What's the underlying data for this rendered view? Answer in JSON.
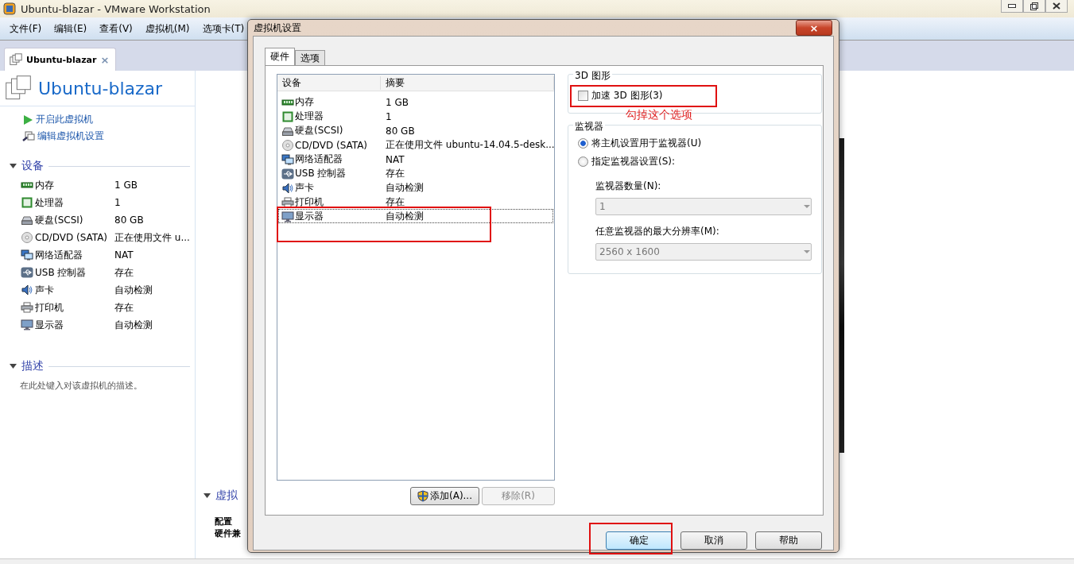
{
  "window": {
    "title": "Ubuntu-blazar - VMware Workstation"
  },
  "menu": [
    "文件(F)",
    "编辑(E)",
    "查看(V)",
    "虚拟机(M)",
    "选项卡(T)"
  ],
  "tabs": [
    {
      "label": "Ubuntu-blazar",
      "selected": true,
      "close": "×"
    }
  ],
  "vm": {
    "name": "Ubuntu-blazar",
    "actions": [
      {
        "kind": "play",
        "label": "开启此虚拟机"
      },
      {
        "kind": "edit",
        "label": "编辑虚拟机设置"
      }
    ],
    "devices_section": {
      "title": "设备",
      "expanded": true,
      "items": [
        {
          "kind": "memory",
          "name": "内存",
          "summary": "1 GB"
        },
        {
          "kind": "cpu",
          "name": "处理器",
          "summary": "1"
        },
        {
          "kind": "disk",
          "name": "硬盘(SCSI)",
          "summary": "80 GB"
        },
        {
          "kind": "cdrom",
          "name": "CD/DVD (SATA)",
          "summary": "正在使用文件 u..."
        },
        {
          "kind": "network",
          "name": "网络适配器",
          "summary": "NAT"
        },
        {
          "kind": "usb",
          "name": "USB 控制器",
          "summary": "存在"
        },
        {
          "kind": "sound",
          "name": "声卡",
          "summary": "自动检测"
        },
        {
          "kind": "printer",
          "name": "打印机",
          "summary": "存在"
        },
        {
          "kind": "display",
          "name": "显示器",
          "summary": "自动检测"
        }
      ]
    },
    "description_section": {
      "title": "描述",
      "expanded": true,
      "placeholder": "在此处键入对该虚拟机的描述。"
    },
    "details_section": {
      "title": "虚拟",
      "expanded": true,
      "labels": [
        "配置",
        "硬件兼"
      ]
    }
  },
  "dialog": {
    "title": "虚拟机设置",
    "close": "×",
    "tabs": [
      {
        "label": "硬件",
        "selected": true
      },
      {
        "label": "选项",
        "selected": false
      }
    ],
    "device_table": {
      "columns": [
        "设备",
        "摘要"
      ],
      "rows": [
        {
          "kind": "memory",
          "name": "内存",
          "summary": "1 GB",
          "selected": false,
          "highlighted": false
        },
        {
          "kind": "cpu",
          "name": "处理器",
          "summary": "1",
          "selected": false,
          "highlighted": false
        },
        {
          "kind": "disk",
          "name": "硬盘(SCSI)",
          "summary": "80 GB",
          "selected": false,
          "highlighted": false
        },
        {
          "kind": "cdrom",
          "name": "CD/DVD (SATA)",
          "summary": "正在使用文件 ubuntu-14.04.5-desk...",
          "selected": false,
          "highlighted": false
        },
        {
          "kind": "network",
          "name": "网络适配器",
          "summary": "NAT",
          "selected": false,
          "highlighted": false
        },
        {
          "kind": "usb",
          "name": "USB 控制器",
          "summary": "存在",
          "selected": false,
          "highlighted": false
        },
        {
          "kind": "sound",
          "name": "声卡",
          "summary": "自动检测",
          "selected": false,
          "highlighted": false
        },
        {
          "kind": "printer",
          "name": "打印机",
          "summary": "存在",
          "selected": false,
          "highlighted": false
        },
        {
          "kind": "display",
          "name": "显示器",
          "summary": "自动检测",
          "selected": true,
          "highlighted": true
        }
      ]
    },
    "list_buttons": [
      {
        "kind": "shield",
        "label": "添加(A)...",
        "disabled": false
      },
      {
        "kind": "plain",
        "label": "移除(R)",
        "disabled": true
      }
    ],
    "graphics": {
      "title": "3D 图形",
      "accelerate": {
        "label": "加速 3D 图形(3)",
        "checked": false,
        "highlighted": true
      },
      "note": "勾掉这个选项"
    },
    "monitors": {
      "title": "监视器",
      "options": [
        {
          "label": "将主机设置用于监视器(U)",
          "selected": true
        },
        {
          "label": "指定监视器设置(S):",
          "selected": false
        }
      ],
      "count": {
        "label": "监视器数量(N):",
        "value": "1",
        "disabled": true
      },
      "resolution": {
        "label": "任意监视器的最大分辨率(M):",
        "value": "2560 x 1600",
        "disabled": true
      }
    },
    "buttons": [
      {
        "label": "确定",
        "default": true,
        "highlighted": true
      },
      {
        "label": "取消",
        "default": false,
        "highlighted": false
      },
      {
        "label": "帮助",
        "default": false,
        "highlighted": false
      }
    ]
  }
}
